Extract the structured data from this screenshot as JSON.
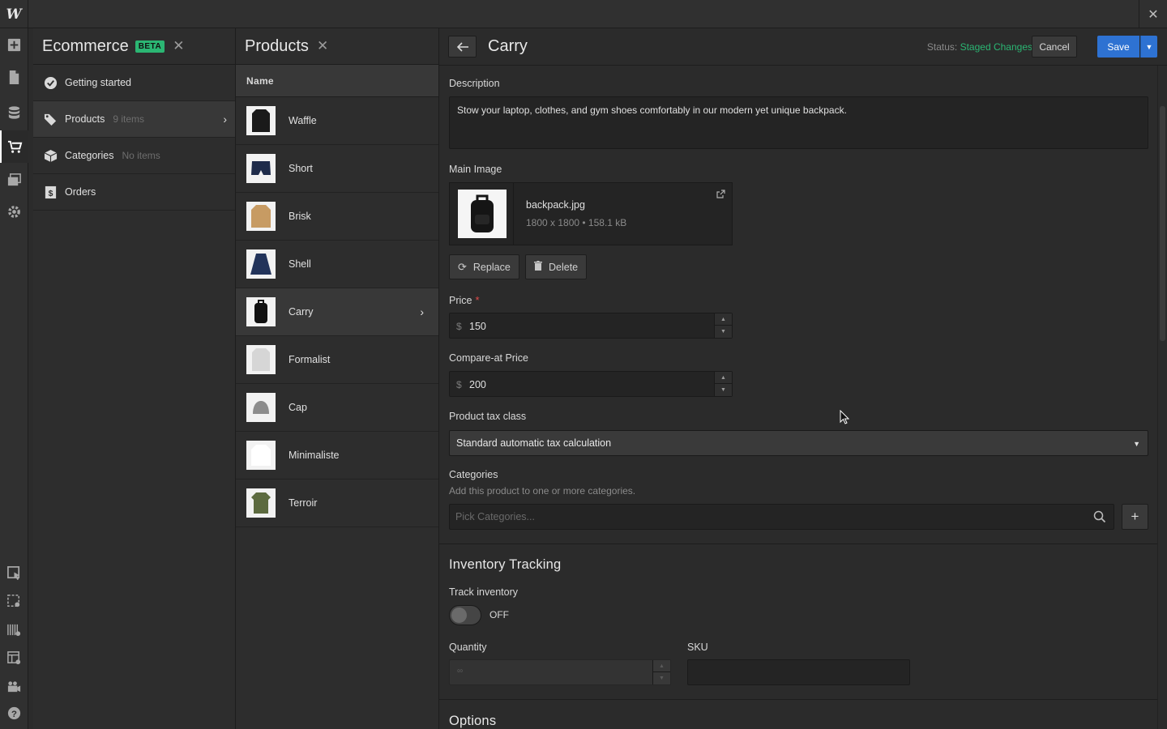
{
  "app": {
    "logo": "W",
    "close_glyph": "✕"
  },
  "ecommerce": {
    "title": "Ecommerce",
    "badge": "BETA",
    "nav": [
      {
        "label": "Getting started",
        "count": ""
      },
      {
        "label": "Products",
        "count": "9 items"
      },
      {
        "label": "Categories",
        "count": "No items"
      },
      {
        "label": "Orders",
        "count": ""
      }
    ]
  },
  "products": {
    "title": "Products",
    "column_header": "Name",
    "items": [
      {
        "name": "Waffle"
      },
      {
        "name": "Short"
      },
      {
        "name": "Brisk"
      },
      {
        "name": "Shell"
      },
      {
        "name": "Carry"
      },
      {
        "name": "Formalist"
      },
      {
        "name": "Cap"
      },
      {
        "name": "Minimaliste"
      },
      {
        "name": "Terroir"
      }
    ]
  },
  "editor": {
    "title": "Carry",
    "status_label": "Status:",
    "status_value": "Staged Changes",
    "cancel": "Cancel",
    "save": "Save",
    "description_label": "Description",
    "description_value": "Stow your laptop, clothes, and gym shoes comfortably in our modern yet unique backpack.",
    "main_image_label": "Main Image",
    "image_name": "backpack.jpg",
    "image_meta": "1800 x 1800 • 158.1 kB",
    "replace": "Replace",
    "delete": "Delete",
    "price_label": "Price",
    "price_required": "*",
    "currency": "$",
    "price_value": "150",
    "compare_label": "Compare-at Price",
    "compare_value": "200",
    "tax_label": "Product tax class",
    "tax_value": "Standard automatic tax calculation",
    "categories_label": "Categories",
    "categories_hint": "Add this product to one or more categories.",
    "categories_placeholder": "Pick Categories...",
    "inventory_title": "Inventory Tracking",
    "track_label": "Track inventory",
    "track_state": "OFF",
    "quantity_label": "Quantity",
    "quantity_value": "∞",
    "sku_label": "SKU",
    "options_title": "Options"
  },
  "colors": {
    "accent": "#2e72d2",
    "status_green": "#2bb673",
    "required": "#e04b4b"
  }
}
